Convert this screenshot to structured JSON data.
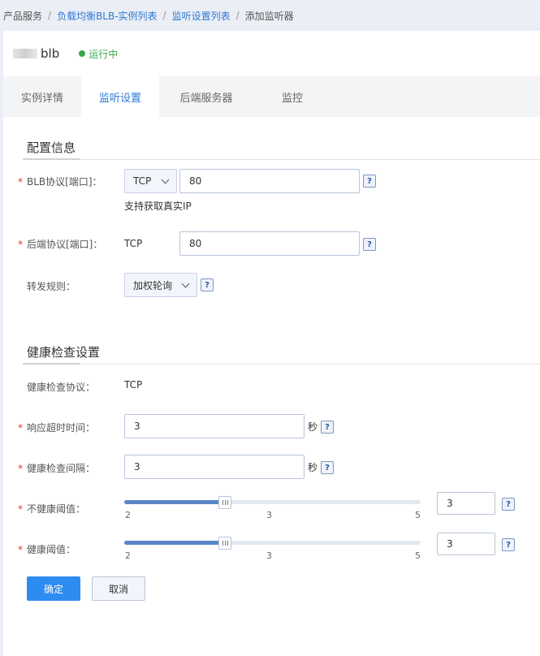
{
  "breadcrumb": {
    "items": [
      {
        "label": "产品服务",
        "link": false
      },
      {
        "label": "负载均衡BLB-实例列表",
        "link": true
      },
      {
        "label": "监听设置列表",
        "link": true
      },
      {
        "label": "添加监听器",
        "link": false
      }
    ],
    "separator": "/"
  },
  "instance": {
    "name": "blb",
    "status": "运行中",
    "status_color": "#3aa64a"
  },
  "tabs": [
    {
      "label": "实例详情",
      "active": false
    },
    {
      "label": "监听设置",
      "active": true
    },
    {
      "label": "后端服务器",
      "active": false
    },
    {
      "label": "监控",
      "active": false
    }
  ],
  "config": {
    "title": "配置信息",
    "blb_protocol": {
      "label": "BLB协议[端口]：",
      "protocol": "TCP",
      "port": "80",
      "hint": "支持获取真实IP"
    },
    "backend_protocol": {
      "label": "后端协议[端口]：",
      "protocol": "TCP",
      "port": "80"
    },
    "forward_rule": {
      "label": "转发规则：",
      "value": "加权轮询"
    }
  },
  "health": {
    "title": "健康检查设置",
    "protocol": {
      "label": "健康检查协议：",
      "value": "TCP"
    },
    "timeout": {
      "label": "响应超时时间：",
      "value": "3",
      "unit": "秒"
    },
    "interval": {
      "label": "健康检查间隔：",
      "value": "3",
      "unit": "秒"
    },
    "unhealthy_threshold": {
      "label": "不健康阈值：",
      "value": "3",
      "min": 2,
      "max": 5,
      "ticks": [
        "2",
        "3",
        "5"
      ],
      "slider_fraction": 0.34
    },
    "healthy_threshold": {
      "label": "健康阈值：",
      "value": "3",
      "min": 2,
      "max": 5,
      "ticks": [
        "2",
        "3",
        "5"
      ],
      "slider_fraction": 0.34
    }
  },
  "help_glyph": "?",
  "required_mark": "*",
  "buttons": {
    "confirm": "确定",
    "cancel": "取消"
  },
  "colors": {
    "accent": "#2d7ad6",
    "primary_button": "#2d8cf0",
    "required": "#e0362e",
    "slider_fill": "#5b86c9"
  }
}
